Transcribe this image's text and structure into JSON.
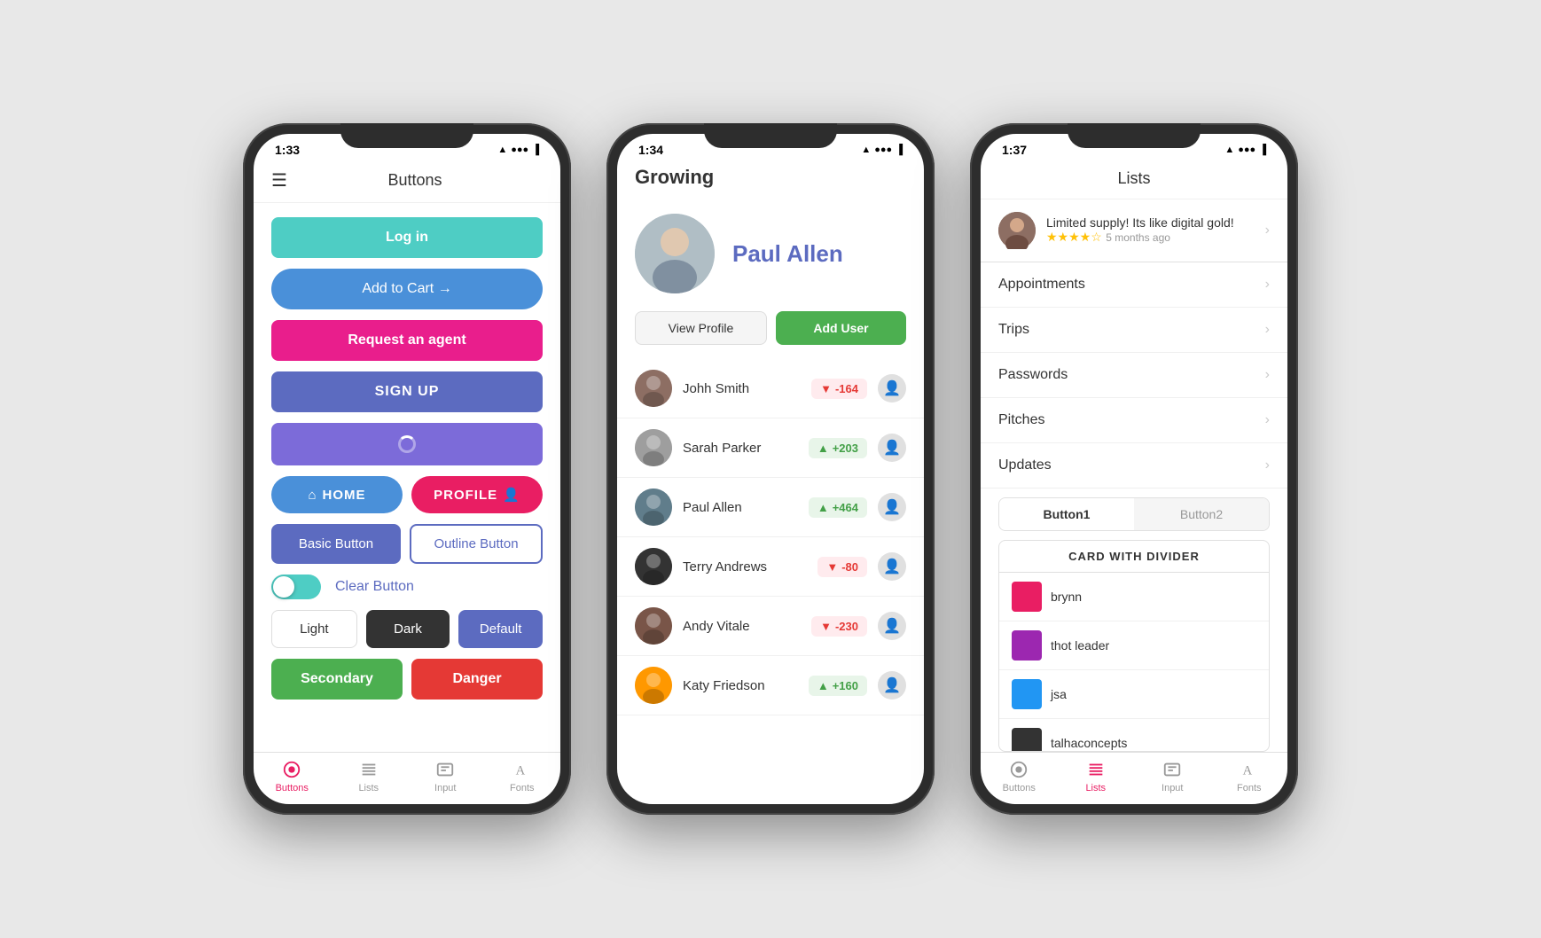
{
  "phone1": {
    "statusTime": "1:33",
    "title": "Buttons",
    "buttons": {
      "login": "Log in",
      "addToCart": "Add to Cart →",
      "requestAgent": "Request an agent",
      "signUp": "SIGN UP",
      "home": "HOME",
      "profile": "PROFILE",
      "basic": "Basic Button",
      "outline": "Outline Button",
      "clear": "Clear Button",
      "light": "Light",
      "dark": "Dark",
      "default": "Default",
      "secondary": "Secondary",
      "danger": "Danger"
    },
    "nav": {
      "buttons": "Buttons",
      "lists": "Lists",
      "input": "Input",
      "fonts": "Fonts"
    }
  },
  "phone2": {
    "statusTime": "1:34",
    "appName": "Growing",
    "profileName": "Paul Allen",
    "viewProfile": "View Profile",
    "addUser": "Add User",
    "users": [
      {
        "name": "Johh Smith",
        "score": "-164",
        "type": "neg"
      },
      {
        "name": "Sarah Parker",
        "score": "+203",
        "type": "pos"
      },
      {
        "name": "Paul Allen",
        "score": "+464",
        "type": "pos"
      },
      {
        "name": "Terry Andrews",
        "score": "-80",
        "type": "neg"
      },
      {
        "name": "Andy Vitale",
        "score": "-230",
        "type": "neg"
      },
      {
        "name": "Katy Friedson",
        "score": "+160",
        "type": "pos"
      }
    ]
  },
  "phone3": {
    "statusTime": "1:37",
    "title": "Lists",
    "reviewText": "Limited supply! Its like digital gold!",
    "reviewTime": "5 months ago",
    "reviewStars": "★★★★☆",
    "listItems": [
      "Appointments",
      "Trips",
      "Passwords",
      "Pitches",
      "Updates"
    ],
    "tabs": [
      "Button1",
      "Button2"
    ],
    "cardTitle": "CARD WITH DIVIDER",
    "cardUsers": [
      "brynn",
      "thot leader",
      "jsa",
      "talhaconcepts"
    ],
    "nav": {
      "buttons": "Buttons",
      "lists": "Lists",
      "input": "Input",
      "fonts": "Fonts"
    }
  }
}
